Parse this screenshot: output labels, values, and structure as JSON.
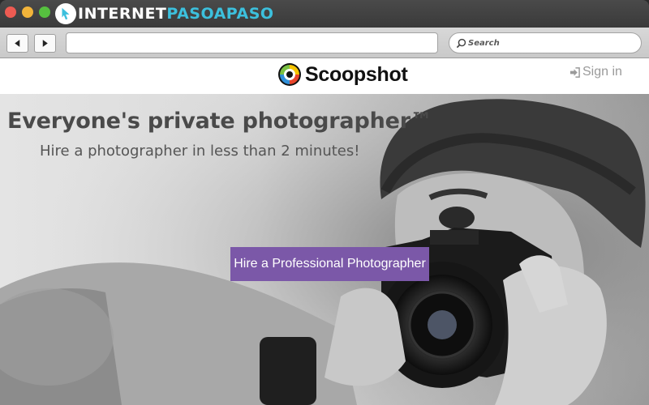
{
  "browser": {
    "brand_prefix": "INTERNET",
    "brand_accent": "PASOAPASO",
    "search_placeholder": "Search"
  },
  "header": {
    "logo_text": "Scoopshot",
    "signin_label": "Sign in"
  },
  "hero": {
    "headline": "Everyone's private photographer™",
    "subheadline": "Hire a photographer in less than 2 minutes!",
    "cta_label": "Hire a Professional Photographer"
  },
  "colors": {
    "cta_background": "#7b58a8",
    "brand_accent": "#3cc0dd",
    "signin_text": "#9a9a9a"
  }
}
